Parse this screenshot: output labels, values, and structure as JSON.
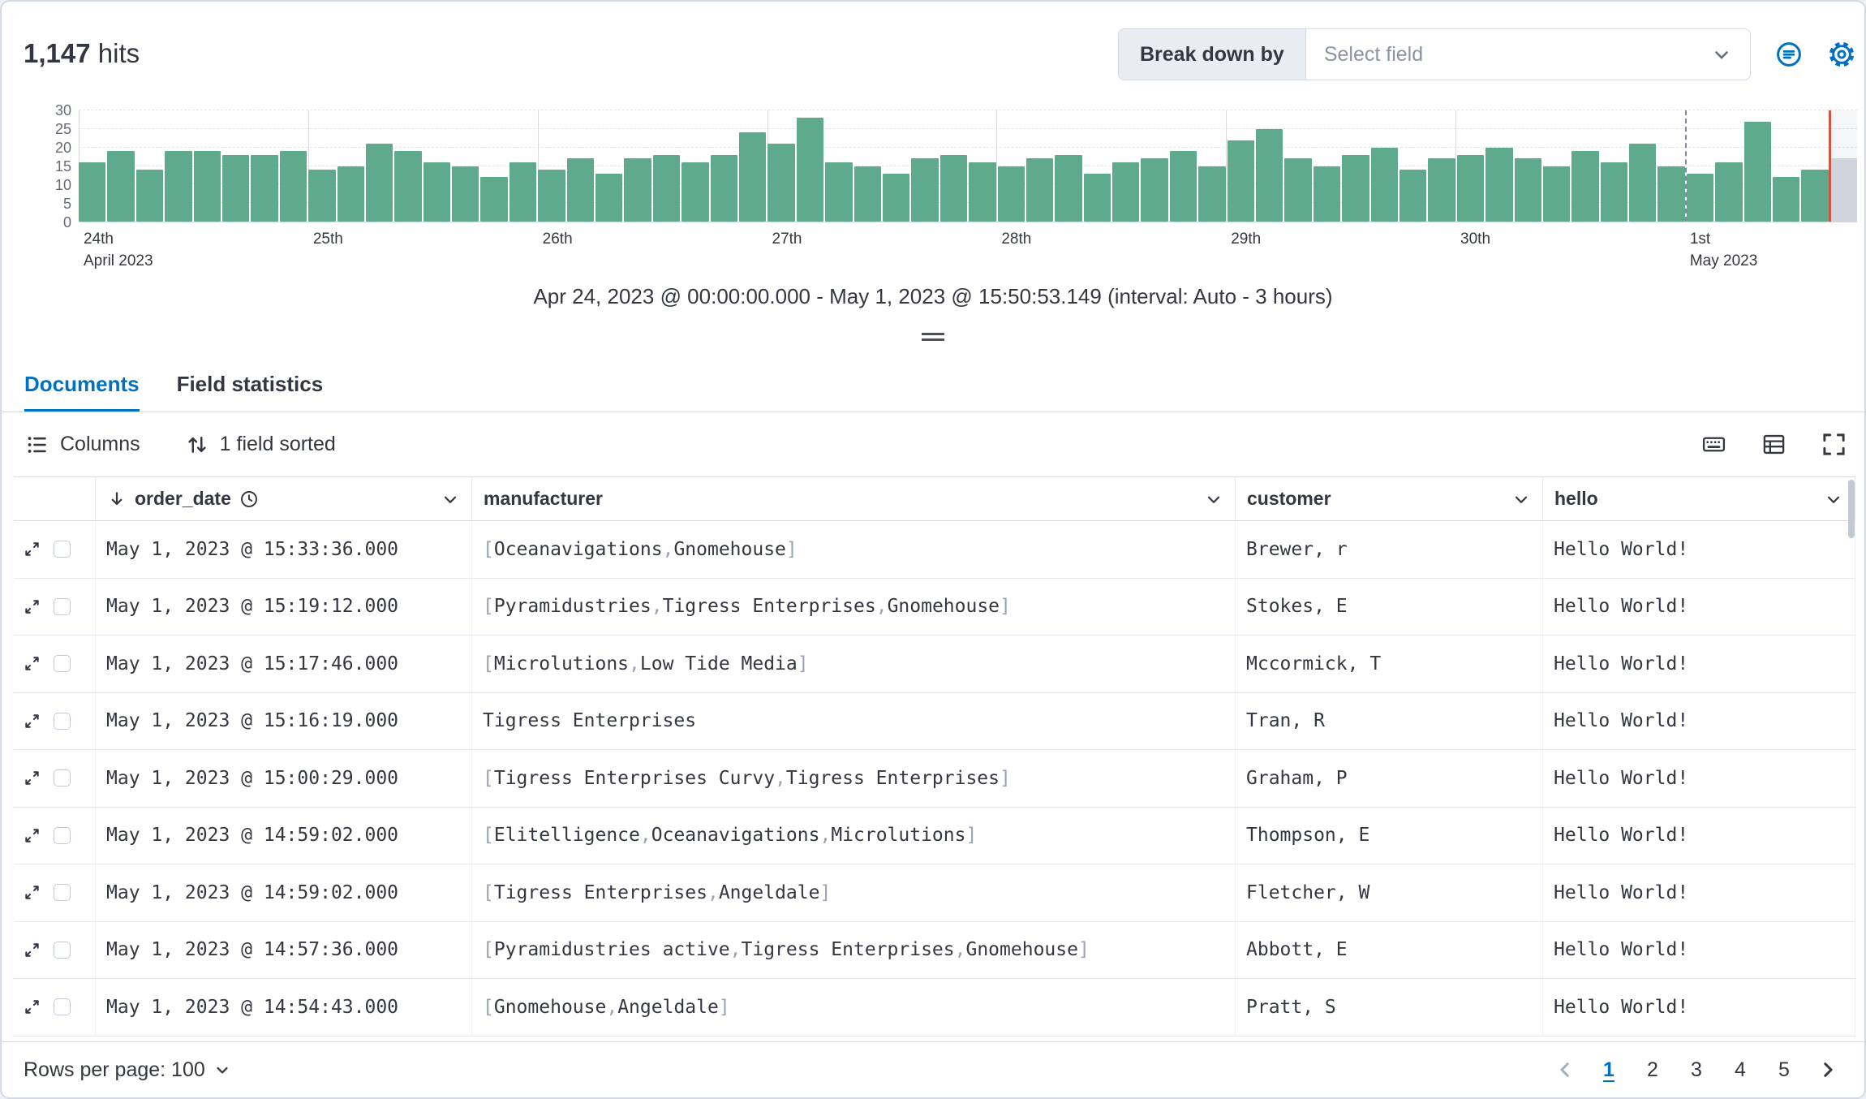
{
  "header": {
    "hits_count": "1,147",
    "hits_label": "hits",
    "breakdown_label": "Break down by",
    "breakdown_placeholder": "Select field"
  },
  "icons": [
    "chart-options-icon",
    "gear-icon",
    "list-icon",
    "sort-fields-icon",
    "keyboard-shortcuts-icon",
    "display-options-icon",
    "fullscreen-icon",
    "expand-document-icon",
    "arrow-down-icon",
    "clock-icon",
    "chevron-down-icon",
    "chevron-left-icon",
    "chevron-right-icon"
  ],
  "chart_data": {
    "type": "bar",
    "title": "Document count over time",
    "xlabel": "",
    "ylabel": "",
    "ylim": [
      0,
      30
    ],
    "yticks": [
      0,
      5,
      10,
      15,
      20,
      25,
      30
    ],
    "grid": true,
    "bar_color": "#5FA98D",
    "current_time_color": "#CC5642",
    "values": [
      16,
      19,
      14,
      19,
      19,
      18,
      18,
      19,
      14,
      15,
      21,
      19,
      16,
      15,
      12,
      16,
      14,
      17,
      13,
      17,
      18,
      16,
      18,
      24,
      21,
      28,
      16,
      15,
      13,
      17,
      18,
      16,
      15,
      17,
      18,
      13,
      16,
      17,
      19,
      15,
      22,
      25,
      17,
      15,
      18,
      20,
      14,
      17,
      18,
      20,
      17,
      15,
      19,
      16,
      21,
      15,
      13,
      16,
      27,
      12,
      14
    ],
    "partial_bucket_value": 17,
    "x_ticks": [
      {
        "label": "24th",
        "sub": "April 2023",
        "index": 0
      },
      {
        "label": "25th",
        "index": 8
      },
      {
        "label": "26th",
        "index": 16
      },
      {
        "label": "27th",
        "index": 24
      },
      {
        "label": "28th",
        "index": 32
      },
      {
        "label": "29th",
        "index": 40
      },
      {
        "label": "30th",
        "index": 48
      },
      {
        "label": "1st",
        "sub": "May 2023",
        "index": 56,
        "dashed": true
      }
    ],
    "caption": "Apr 24, 2023 @ 00:00:00.000 - May 1, 2023 @ 15:50:53.149 (interval: Auto - 3 hours)"
  },
  "tabs": [
    {
      "label": "Documents",
      "active": true
    },
    {
      "label": "Field statistics",
      "active": false
    }
  ],
  "toolbar": {
    "columns_label": "Columns",
    "sorted_label": "1 field sorted"
  },
  "table": {
    "columns": [
      {
        "label": "order_date",
        "sorted": "desc",
        "time_field": true
      },
      {
        "label": "manufacturer"
      },
      {
        "label": "customer"
      },
      {
        "label": "hello"
      }
    ],
    "rows": [
      {
        "order_date": "May 1, 2023 @ 15:33:36.000",
        "manufacturer": "[Oceanavigations, Gnomehouse]",
        "customer": "Brewer, r",
        "hello": "Hello World!"
      },
      {
        "order_date": "May 1, 2023 @ 15:19:12.000",
        "manufacturer": "[Pyramidustries, Tigress Enterprises, Gnomehouse]",
        "customer": "Stokes, E",
        "hello": "Hello World!"
      },
      {
        "order_date": "May 1, 2023 @ 15:17:46.000",
        "manufacturer": "[Microlutions, Low Tide Media]",
        "customer": "Mccormick, T",
        "hello": "Hello World!"
      },
      {
        "order_date": "May 1, 2023 @ 15:16:19.000",
        "manufacturer": "Tigress Enterprises",
        "customer": "Tran, R",
        "hello": "Hello World!"
      },
      {
        "order_date": "May 1, 2023 @ 15:00:29.000",
        "manufacturer": "[Tigress Enterprises Curvy, Tigress Enterprises]",
        "customer": "Graham, P",
        "hello": "Hello World!"
      },
      {
        "order_date": "May 1, 2023 @ 14:59:02.000",
        "manufacturer": "[Elitelligence, Oceanavigations, Microlutions]",
        "customer": "Thompson, E",
        "hello": "Hello World!"
      },
      {
        "order_date": "May 1, 2023 @ 14:59:02.000",
        "manufacturer": "[Tigress Enterprises, Angeldale]",
        "customer": "Fletcher, W",
        "hello": "Hello World!"
      },
      {
        "order_date": "May 1, 2023 @ 14:57:36.000",
        "manufacturer": "[Pyramidustries active, Tigress Enterprises, Gnomehouse]",
        "customer": "Abbott, E",
        "hello": "Hello World!"
      },
      {
        "order_date": "May 1, 2023 @ 14:54:43.000",
        "manufacturer": "[Gnomehouse, Angeldale]",
        "customer": "Pratt, S",
        "hello": "Hello World!"
      }
    ]
  },
  "footer": {
    "rows_per_page_label": "Rows per page: 100",
    "pages": [
      "1",
      "2",
      "3",
      "4",
      "5"
    ],
    "active_page": "1"
  }
}
